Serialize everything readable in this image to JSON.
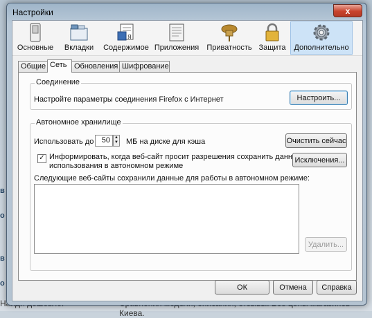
{
  "window": {
    "title": "Настройки",
    "close_glyph": "x"
  },
  "background": {
    "left_text": "Найди дешевле.",
    "right_text": "Сравнения модели, описания, отзывы. Все цены магазинов Киева.",
    "side_marks": [
      "в",
      "о",
      "в",
      "о"
    ]
  },
  "toolbar": {
    "items": [
      {
        "label": "Основные",
        "icon": "switch-icon"
      },
      {
        "label": "Вкладки",
        "icon": "tabs-icon"
      },
      {
        "label": "Содержимое",
        "icon": "content-icon"
      },
      {
        "label": "Приложения",
        "icon": "applications-icon"
      },
      {
        "label": "Приватность",
        "icon": "privacy-mask-icon"
      },
      {
        "label": "Защита",
        "icon": "lock-icon"
      },
      {
        "label": "Дополнительно",
        "icon": "gear-icon"
      }
    ],
    "active_index": 6
  },
  "tabs": {
    "items": [
      "Общие",
      "Сеть",
      "Обновления",
      "Шифрование"
    ],
    "active_index": 1
  },
  "connection": {
    "title": "Соединение",
    "description": "Настройте параметры соединения Firefox с Интернет",
    "configure_label": "Настроить..."
  },
  "offline": {
    "title": "Автономное хранилище",
    "use_up_to": "Использовать до",
    "cache_value": "50",
    "cache_unit": "МБ на диске для кэша",
    "clear_now_label": "Очистить сейчас",
    "notify_checked": true,
    "notify_line1": "Информировать, когда веб-сайт просит разрешения сохранить данные для",
    "notify_line2": "использования в автономном режиме",
    "exceptions_label": "Исключения...",
    "sites_label": "Следующие веб-сайты сохранили данные для работы в автономном режиме:",
    "sites": [],
    "remove_label": "Удалить..."
  },
  "footer": {
    "ok_label": "ОК",
    "cancel_label": "Отмена",
    "help_label": "Справка"
  },
  "colors": {
    "active_toolbar_bg": "#cde3f7",
    "close_button": "#c8432d"
  }
}
